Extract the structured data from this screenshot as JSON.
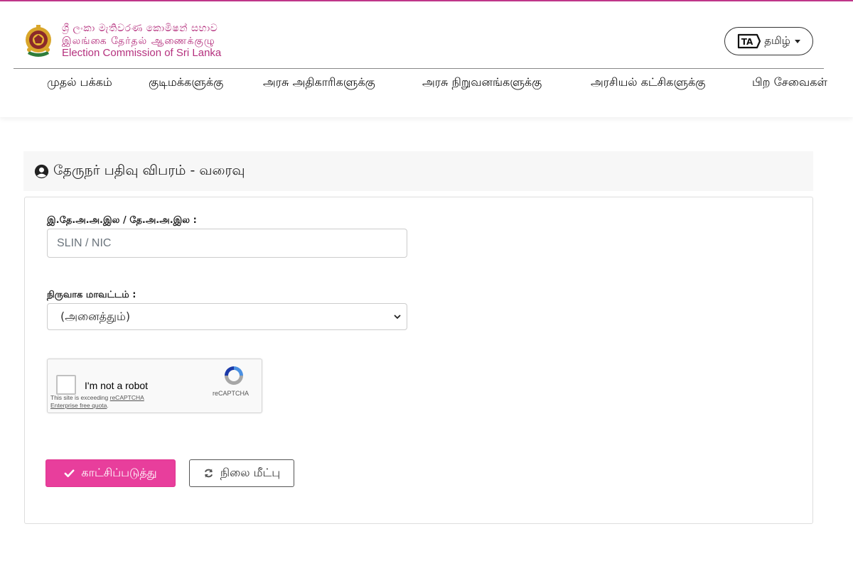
{
  "header": {
    "logo_sinhala": "ශ්‍රී ලංකා මැතිවරණ කොමිෂන් සභාව",
    "logo_tamil": "இலங்கை தேர்தல் ஆணைக்குழு",
    "logo_english": "Election Commission of Sri Lanka",
    "language_label": "தமிழ்",
    "language_badge": "TA"
  },
  "nav": {
    "items": [
      {
        "label": "முதல் பக்கம்"
      },
      {
        "label": "குடிமக்களுக்கு"
      },
      {
        "label": "அரசு அதிகாரிகளுக்கு"
      },
      {
        "label": "அரசு நிறுவனங்களுக்கு"
      },
      {
        "label": "அரசியல் கட்சிகளுக்கு"
      },
      {
        "label": "பிற சேவைகள்"
      }
    ]
  },
  "panel": {
    "title": "தேருநர் பதிவு விபரம் - வரைவு"
  },
  "form": {
    "id_label": "இ.தே.அ.அ.இல / தே.அ.அ.இல :",
    "id_placeholder": "SLIN / NIC",
    "district_label": "நிருவாக மாவட்டம் :",
    "district_selected": "(அனைத்தும்)"
  },
  "recaptcha": {
    "label": "I'm not a robot",
    "note_prefix": "This site is exceeding ",
    "note_link": "reCAPTCHA Enterprise free quota",
    "note_suffix": ".",
    "brand": "reCAPTCHA"
  },
  "buttons": {
    "show_label": "காட்சிப்படுத்து",
    "reset_label": "நிலை மீட்பு"
  },
  "colors": {
    "accent": "#e83e9c",
    "brand": "#b5317e"
  }
}
